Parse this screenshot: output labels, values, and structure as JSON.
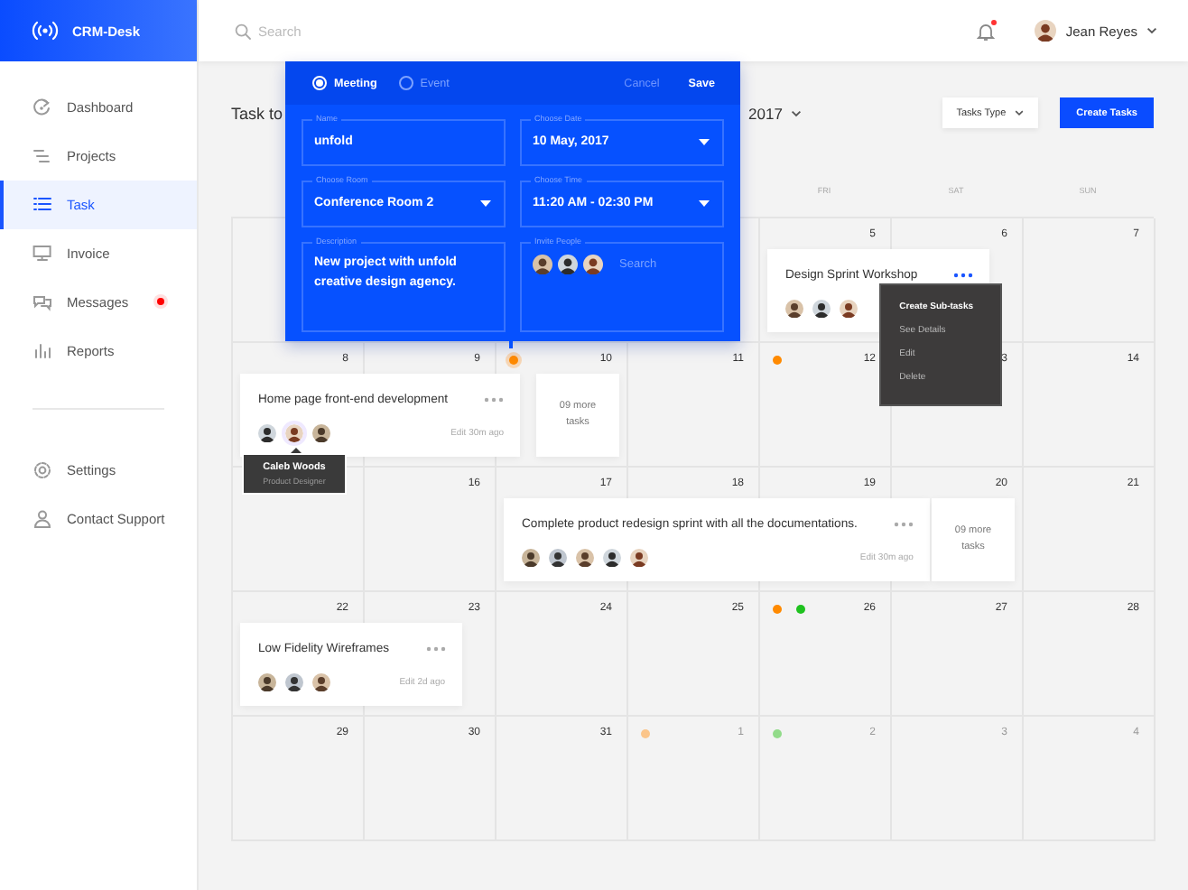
{
  "app": {
    "name": "CRM-Desk"
  },
  "sidebar": {
    "items": [
      {
        "label": "Dashboard",
        "selected": false,
        "notification": false
      },
      {
        "label": "Projects",
        "selected": false,
        "notification": false
      },
      {
        "label": "Task",
        "selected": true,
        "notification": false
      },
      {
        "label": "Invoice",
        "selected": false,
        "notification": false
      },
      {
        "label": "Messages",
        "selected": false,
        "notification": true
      },
      {
        "label": "Reports",
        "selected": false,
        "notification": false
      }
    ],
    "footer_items": [
      {
        "label": "Settings",
        "selected": false
      },
      {
        "label": "Contact Support",
        "selected": false
      }
    ]
  },
  "topbar": {
    "search": {
      "placeholder": "Search"
    },
    "notification": true,
    "user": {
      "name": "Jean Reyes"
    }
  },
  "page": {
    "title": "Task to",
    "month": "2017",
    "filter": "Tasks Type",
    "create_button": "Create Tasks"
  },
  "calendar": {
    "weekdays": [
      "FRI",
      "SAT",
      "SUN"
    ],
    "weeks": [
      {
        "days": [
          {
            "date": "5",
            "other_month": false,
            "task": {
              "title": "Design Sprint Workshop",
              "avatars": [
                {
                  "hovered": false
                },
                {
                  "hovered": false
                },
                {
                  "hovered": false
                }
              ],
              "menu": [
                {
                  "label": "Create Sub-tasks",
                  "selected": true
                },
                {
                  "label": "See Details",
                  "selected": false
                },
                {
                  "label": "Edit",
                  "selected": false
                },
                {
                  "label": "Delete",
                  "selected": false
                }
              ]
            }
          },
          {
            "date": "6",
            "other_month": false
          },
          {
            "date": "7",
            "other_month": false
          }
        ]
      },
      {
        "days": [
          {
            "date": "8",
            "other_month": false,
            "task": {
              "title": "Home page front-end development",
              "edited": "Edit 30m ago",
              "avatars": [
                {
                  "hovered": false
                },
                {
                  "hovered": true,
                  "tooltip": {
                    "name": "Caleb Woods",
                    "role": "Product Designer"
                  }
                },
                {
                  "hovered": false
                }
              ]
            }
          },
          {
            "date": "9",
            "other_month": false
          },
          {
            "date": "10",
            "other_month": false,
            "dots": [
              {
                "color": "#ff8a00",
                "highlighted": true
              }
            ],
            "more_tasks": "09 more tasks"
          },
          {
            "date": "11",
            "other_month": false
          },
          {
            "date": "12",
            "other_month": false,
            "dots": [
              {
                "color": "#ff8a00",
                "highlighted": false
              }
            ]
          },
          {
            "date": "3",
            "other_month": false
          },
          {
            "date": "14",
            "other_month": false
          }
        ]
      },
      {
        "days": [
          {
            "date": "16",
            "other_month": false
          },
          {
            "date": "17",
            "other_month": false,
            "task": {
              "title": "Complete product redesign sprint with all the documentations.",
              "edited": "Edit 30m ago",
              "avatars": [
                {
                  "hovered": false
                },
                {
                  "hovered": false
                },
                {
                  "hovered": false
                },
                {
                  "hovered": false
                },
                {
                  "hovered": false
                }
              ]
            }
          },
          {
            "date": "18",
            "other_month": false
          },
          {
            "date": "19",
            "other_month": false
          },
          {
            "date": "20",
            "other_month": false,
            "more_tasks": "09 more tasks"
          },
          {
            "date": "21",
            "other_month": false
          }
        ]
      },
      {
        "days": [
          {
            "date": "22",
            "other_month": false,
            "task": {
              "title": "Low Fidelity Wireframes",
              "edited": "Edit 2d ago",
              "avatars": [
                {
                  "hovered": false
                },
                {
                  "hovered": false
                },
                {
                  "hovered": false
                }
              ]
            }
          },
          {
            "date": "23",
            "other_month": false
          },
          {
            "date": "24",
            "other_month": false
          },
          {
            "date": "25",
            "other_month": false
          },
          {
            "date": "26",
            "other_month": false,
            "dots": [
              {
                "color": "#ff8a00",
                "highlighted": false
              },
              {
                "color": "#1fc21f",
                "highlighted": false
              }
            ]
          },
          {
            "date": "27",
            "other_month": false
          },
          {
            "date": "28",
            "other_month": false
          }
        ]
      },
      {
        "days": [
          {
            "date": "29",
            "other_month": false
          },
          {
            "date": "30",
            "other_month": false
          },
          {
            "date": "31",
            "other_month": false
          },
          {
            "date": "1",
            "other_month": true,
            "dots": [
              {
                "color": "#fbc58a",
                "highlighted": false
              }
            ]
          },
          {
            "date": "2",
            "other_month": true,
            "dots": [
              {
                "color": "#92db8a",
                "highlighted": false
              }
            ]
          },
          {
            "date": "3",
            "other_month": true
          },
          {
            "date": "4",
            "other_month": true
          }
        ]
      }
    ]
  },
  "event_popup": {
    "types": [
      {
        "label": "Meeting",
        "selected": true
      },
      {
        "label": "Event",
        "selected": false
      }
    ],
    "actions": [
      {
        "label": "Cancel",
        "kind": "secondary"
      },
      {
        "label": "Save",
        "kind": "primary"
      }
    ],
    "fields": [
      {
        "label": "Name",
        "value": "unfold",
        "kind": "text"
      },
      {
        "label": "Choose Date",
        "value": "10 May, 2017",
        "kind": "select"
      },
      {
        "label": "Choose Room",
        "value": "Conference Room 2",
        "kind": "select"
      },
      {
        "label": "Choose Time",
        "value": "11:20 AM - 02:30 PM",
        "kind": "select"
      },
      {
        "label": "Description",
        "value": "New project with unfold creative design agency.",
        "kind": "textarea"
      },
      {
        "label": "Invite People",
        "placeholder": "Search",
        "kind": "people",
        "avatars": [
          {
            "hovered": false
          },
          {
            "hovered": false
          },
          {
            "hovered": false
          }
        ]
      }
    ]
  }
}
